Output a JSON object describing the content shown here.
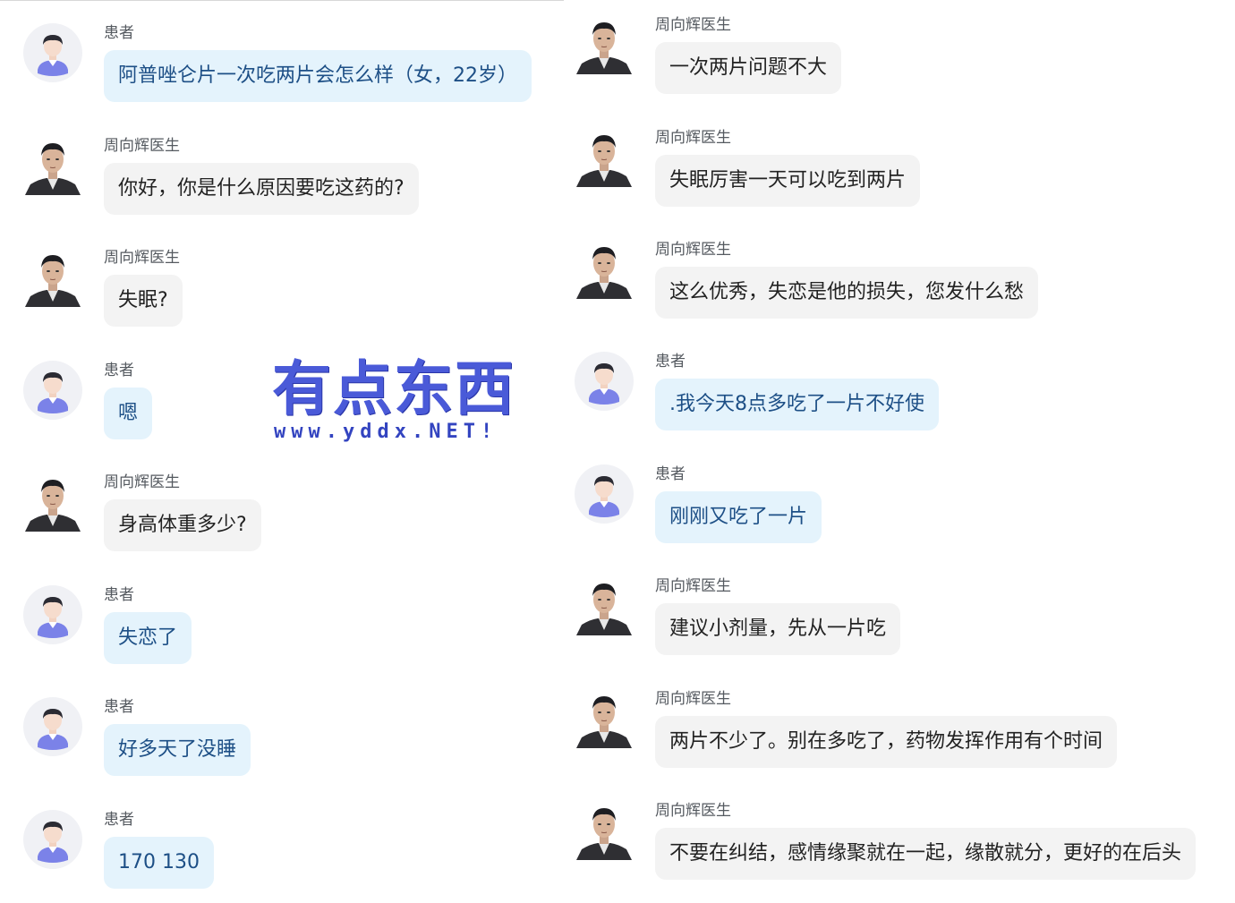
{
  "labels": {
    "patient": "患者",
    "doctor": "周向辉医生"
  },
  "watermark": {
    "title": "有点东西",
    "url": "www.yddx.NET!"
  },
  "left_messages": [
    {
      "sender": "患者",
      "text": "阿普唑仑片一次吃两片会怎么样（女，22岁）",
      "role": "patient"
    },
    {
      "sender": "周向辉医生",
      "text": "你好，你是什么原因要吃这药的?",
      "role": "doctor"
    },
    {
      "sender": "周向辉医生",
      "text": "失眠?",
      "role": "doctor"
    },
    {
      "sender": "患者",
      "text": "嗯",
      "role": "patient"
    },
    {
      "sender": "周向辉医生",
      "text": "身高体重多少?",
      "role": "doctor"
    },
    {
      "sender": "患者",
      "text": "失恋了",
      "role": "patient"
    },
    {
      "sender": "患者",
      "text": "好多天了没睡",
      "role": "patient"
    },
    {
      "sender": "患者",
      "text": "170 130",
      "role": "patient"
    }
  ],
  "right_messages": [
    {
      "sender": "周向辉医生",
      "text": "一次两片问题不大",
      "role": "doctor"
    },
    {
      "sender": "周向辉医生",
      "text": "失眠厉害一天可以吃到两片",
      "role": "doctor"
    },
    {
      "sender": "周向辉医生",
      "text": "这么优秀，失恋是他的损失，您发什么愁",
      "role": "doctor"
    },
    {
      "sender": "患者",
      "text": ".我今天8点多吃了一片不好使",
      "role": "patient"
    },
    {
      "sender": "患者",
      "text": "刚刚又吃了一片",
      "role": "patient"
    },
    {
      "sender": "周向辉医生",
      "text": "建议小剂量，先从一片吃",
      "role": "doctor"
    },
    {
      "sender": "周向辉医生",
      "text": "两片不少了。别在多吃了，药物发挥作用有个时间",
      "role": "doctor"
    },
    {
      "sender": "周向辉医生",
      "text": "不要在纠结，感情缘聚就在一起，缘散就分，更好的在后头",
      "role": "doctor"
    }
  ],
  "colors": {
    "patient_bubble": "#e4f3fc",
    "patient_text": "#1d4f86",
    "doctor_bubble": "#f3f3f3",
    "doctor_text": "#222222",
    "watermark": "#4a5ad8"
  },
  "icons": {
    "patient_avatar": "patient-avatar-icon",
    "doctor_avatar": "doctor-photo-avatar"
  }
}
